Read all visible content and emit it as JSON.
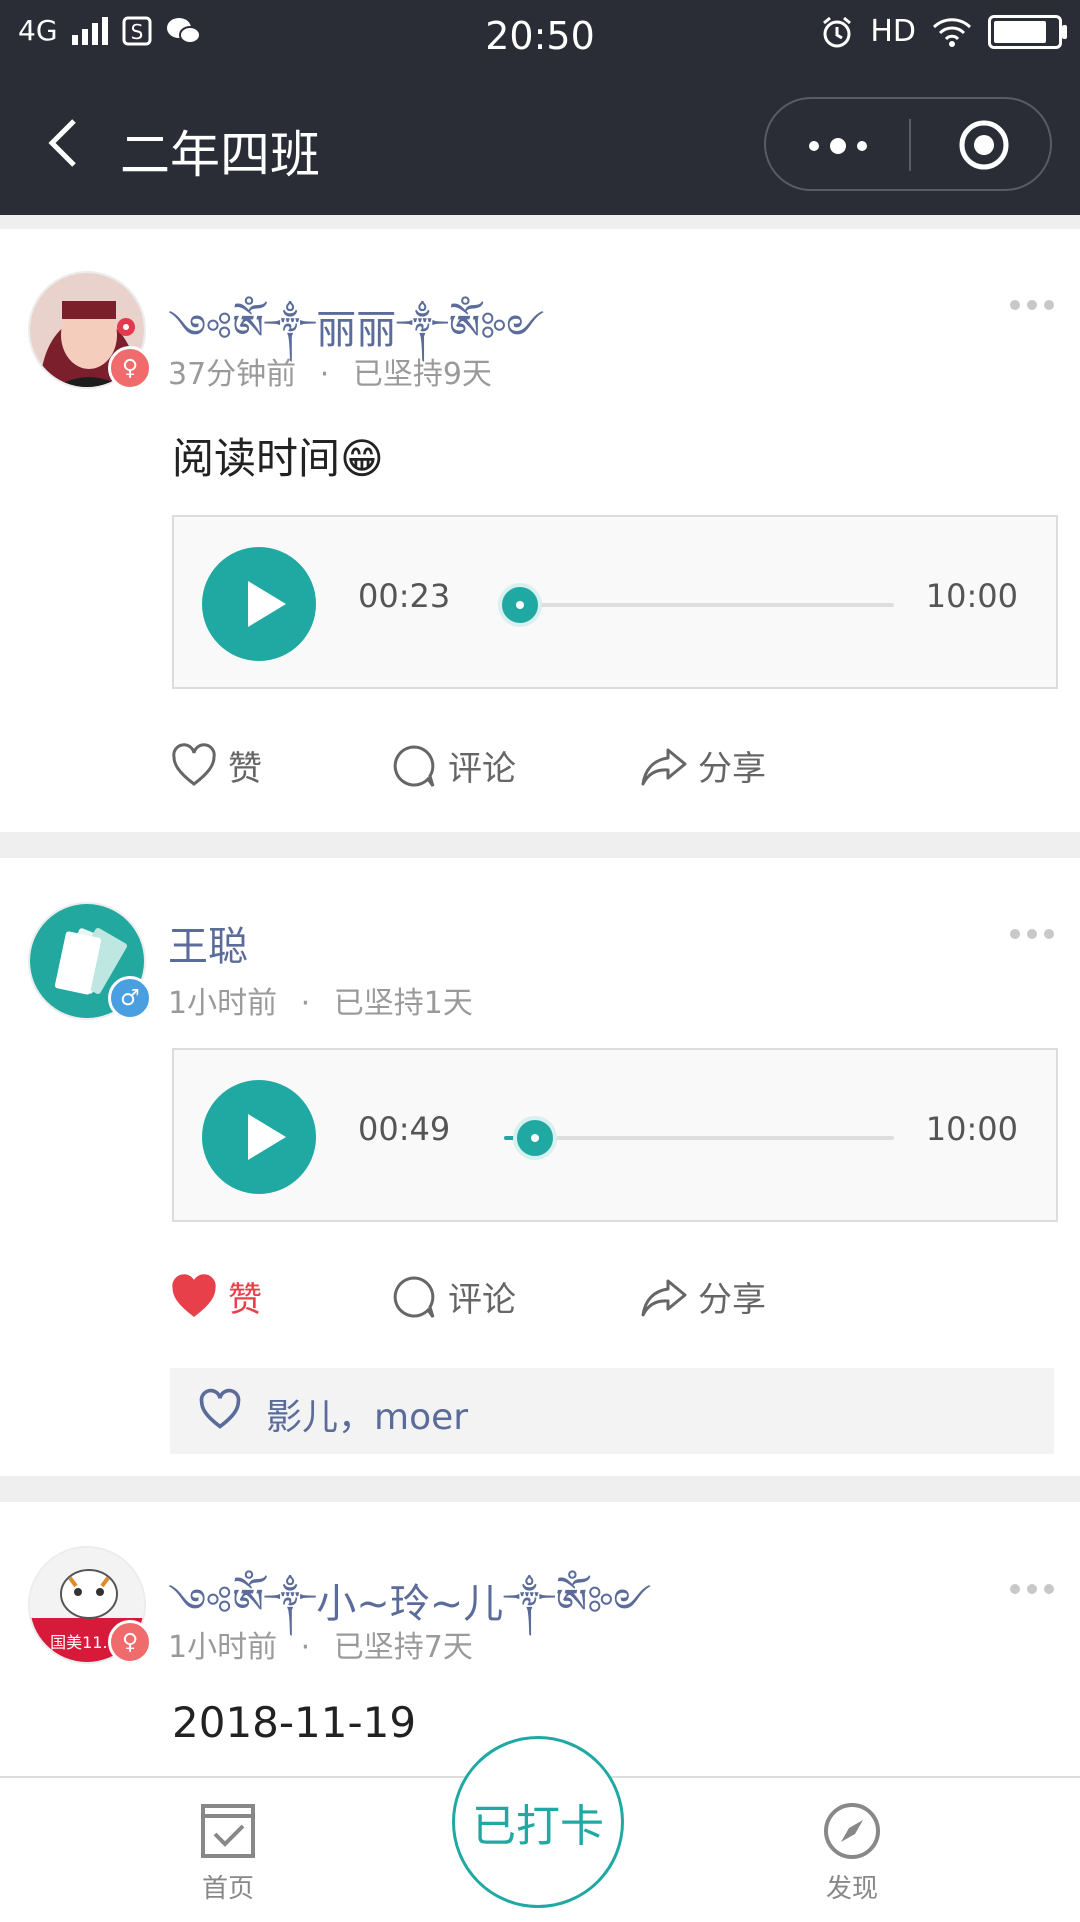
{
  "status_bar": {
    "network": "4G",
    "time": "20:50",
    "hd": "HD"
  },
  "nav": {
    "title": "二年四班"
  },
  "posts": [
    {
      "name": "༺ༀ༒丽丽༒ༀ༻",
      "time": "37分钟前",
      "streak": "已坚持9天",
      "text": "阅读时间😁",
      "audio": {
        "elapsed": "00:23",
        "total": "10:00",
        "progress": 0.04
      },
      "actions": {
        "like": "赞",
        "comment": "评论",
        "share": "分享"
      },
      "liked": false
    },
    {
      "name": "王聪",
      "time": "1小时前",
      "streak": "已坚持1天",
      "audio": {
        "elapsed": "00:49",
        "total": "10:00",
        "progress": 0.08
      },
      "actions": {
        "like": "赞",
        "comment": "评论",
        "share": "分享"
      },
      "liked": true,
      "likes": "影儿，moer"
    },
    {
      "name": "༺ༀ༒小~玲~儿༒ༀ༻",
      "time": "1小时前",
      "streak": "已坚持7天",
      "text": "2018-11-19",
      "avatar_text": "国美11.11"
    }
  ],
  "meta_separator": "·",
  "tabbar": {
    "home": "首页",
    "checkin": "已打卡",
    "discover": "发现"
  },
  "colors": {
    "accent": "#20a9a2",
    "nav_bg": "#2b2d36",
    "like_red": "#e8404a",
    "name_blue": "#5b6c9a"
  }
}
